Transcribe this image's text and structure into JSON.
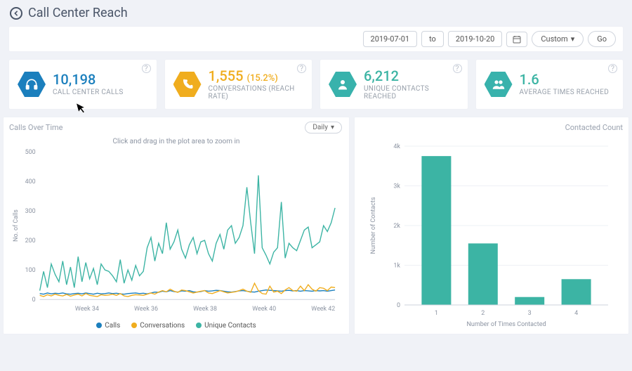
{
  "header": {
    "title": "Call Center Reach"
  },
  "dateBar": {
    "from": "2019-07-01",
    "toLabel": "to",
    "to": "2019-10-20",
    "custom": "Custom",
    "go": "Go"
  },
  "kpis": {
    "calls": {
      "value": "10,198",
      "label": "CALL CENTER CALLS"
    },
    "convs": {
      "value": "1,555",
      "pct": "(15.2%)",
      "label": "CONVERSATIONS (REACH RATE)"
    },
    "unique": {
      "value": "6,212",
      "label": "UNIQUE CONTACTS REACHED"
    },
    "avg": {
      "value": "1.6",
      "label": "AVERAGE TIMES REACHED"
    }
  },
  "left": {
    "title": "Calls Over Time",
    "granularity": "Daily",
    "hint": "Click and drag in the plot area to zoom in",
    "ylabel": "No. of Calls",
    "legend": {
      "a": "Calls",
      "b": "Conversations",
      "c": "Unique Contacts"
    }
  },
  "right": {
    "title": "Contacted Count",
    "ylabel": "Number of Contacts",
    "xlabel": "Number of Times Contacted"
  },
  "chart_data": [
    {
      "type": "line",
      "id": "calls-over-time",
      "title": "Calls Over Time",
      "xlabel": "",
      "ylabel": "No. of Calls",
      "ylim": [
        0,
        500
      ],
      "x_ticks": [
        "Week 34",
        "Week 36",
        "Week 38",
        "Week 40",
        "Week 42"
      ],
      "series": [
        {
          "name": "Calls",
          "color": "#1b7fbd",
          "values": [
            20,
            18,
            22,
            19,
            21,
            20,
            22,
            19,
            18,
            20,
            21,
            19,
            22,
            20,
            18,
            21,
            19,
            20,
            22,
            20,
            21,
            19,
            18,
            20,
            21,
            22,
            20,
            21,
            19,
            22,
            25,
            24,
            28,
            26,
            30,
            27,
            25,
            29,
            28,
            30,
            26,
            25,
            27,
            30,
            28,
            29,
            31,
            30,
            28,
            26,
            25,
            27,
            29,
            30,
            28,
            26,
            25,
            28,
            30,
            32,
            31,
            30,
            29,
            28,
            30,
            31,
            29,
            30,
            28,
            30,
            29,
            28,
            30,
            29,
            30,
            28,
            30,
            32
          ]
        },
        {
          "name": "Conversations",
          "color": "#f0ad1e",
          "values": [
            14,
            10,
            16,
            12,
            18,
            14,
            12,
            17,
            11,
            15,
            18,
            12,
            20,
            14,
            12,
            10,
            16,
            14,
            15,
            18,
            14,
            20,
            12,
            10,
            14,
            16,
            15,
            14,
            18,
            22,
            18,
            25,
            30,
            26,
            35,
            28,
            24,
            32,
            30,
            26,
            22,
            25,
            28,
            30,
            22,
            20,
            25,
            30,
            26,
            22,
            24,
            26,
            30,
            35,
            28,
            24,
            55,
            30,
            20,
            18,
            45,
            25,
            28,
            20,
            32,
            40,
            30,
            28,
            45,
            30,
            50,
            35,
            28,
            40,
            38,
            30,
            42,
            40
          ]
        },
        {
          "name": "Unique Contacts",
          "color": "#3cb4a4",
          "values": [
            30,
            95,
            40,
            120,
            85,
            60,
            130,
            50,
            110,
            40,
            145,
            60,
            125,
            70,
            105,
            50,
            120,
            100,
            95,
            80,
            60,
            135,
            55,
            100,
            65,
            115,
            80,
            95,
            175,
            210,
            130,
            190,
            155,
            260,
            170,
            195,
            235,
            170,
            140,
            185,
            210,
            155,
            195,
            200,
            155,
            130,
            190,
            220,
            170,
            235,
            250,
            190,
            210,
            250,
            380,
            260,
            155,
            420,
            175,
            150,
            120,
            160,
            175,
            330,
            140,
            190,
            175,
            165,
            200,
            235,
            245,
            175,
            185,
            195,
            250,
            230,
            260,
            310
          ]
        }
      ]
    },
    {
      "type": "bar",
      "id": "contacted-count",
      "title": "Contacted Count",
      "xlabel": "Number of Times Contacted",
      "ylabel": "Number of Contacts",
      "ylim": [
        0,
        4000
      ],
      "categories": [
        "1",
        "2",
        "3",
        "4"
      ],
      "values": [
        3750,
        1550,
        200,
        650
      ],
      "color": "#3cb4a4"
    }
  ]
}
